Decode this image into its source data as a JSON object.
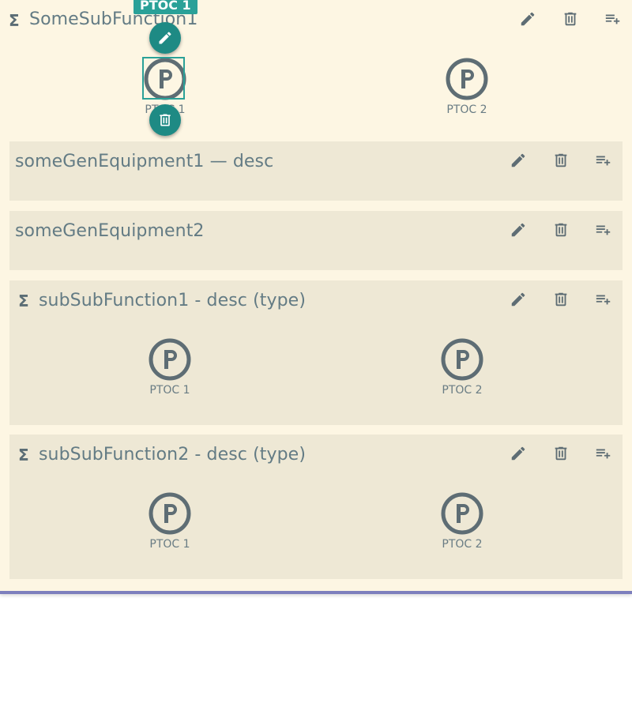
{
  "subfunction": {
    "title": "SomeSubFunction1",
    "selected_tooltip": "PTOC 1",
    "lnodes": [
      {
        "label": "PTOC 1"
      },
      {
        "label": "PTOC 2"
      }
    ]
  },
  "equipment": [
    {
      "title": "someGenEquipment1 — desc"
    },
    {
      "title": "someGenEquipment2"
    }
  ],
  "subsubfunctions": [
    {
      "title": "subSubFunction1 - desc (type)",
      "lnodes": [
        {
          "label": "PTOC 1"
        },
        {
          "label": "PTOC 2"
        }
      ]
    },
    {
      "title": "subSubFunction2 - desc (type)",
      "lnodes": [
        {
          "label": "PTOC 1"
        },
        {
          "label": "PTOC 2"
        }
      ]
    }
  ],
  "icons": {
    "sigma": "Σ",
    "edit": "pencil-icon",
    "delete": "trash-icon",
    "add": "playlist-add-icon",
    "lnode": "p-circle-icon"
  },
  "colors": {
    "background": "#fdf6e3",
    "card": "#eee8d5",
    "accent": "#2aa198",
    "fab": "#1e8a84",
    "icon": "#5e6d74",
    "bottom_border": "#7d7fbd"
  }
}
